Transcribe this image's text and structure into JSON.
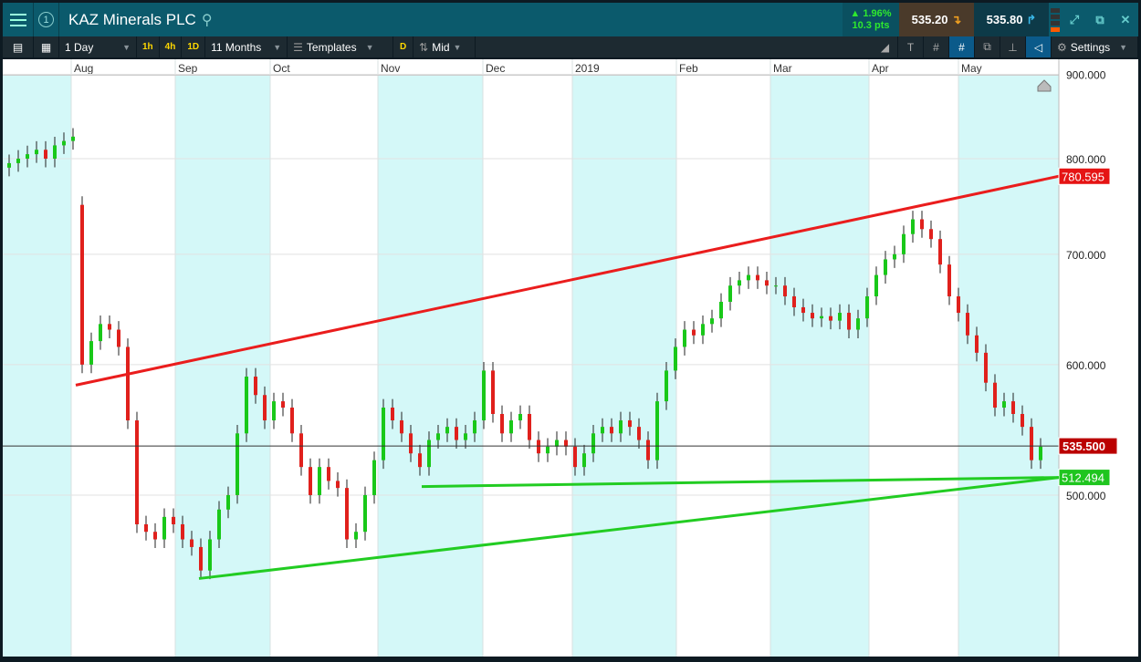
{
  "header": {
    "title": "KAZ Minerals PLC",
    "window_number": "1",
    "change_pct": "▲ 1.96%",
    "change_pts": "10.3 pts",
    "sell": "535.20",
    "buy": "535.80"
  },
  "toolbar": {
    "interval": "1 Day",
    "quick": [
      "1h",
      "4h",
      "1D"
    ],
    "range": "11 Months",
    "templates": "Templates",
    "d": "D",
    "price_type": "Mid",
    "settings": "Settings"
  },
  "colors": {
    "up": "#19c819",
    "down": "#e0201c",
    "band": "#d4f8f8",
    "red_line": "#ea1d1d",
    "green_line": "#22cc22"
  },
  "chart_data": {
    "type": "candlestick",
    "scale": "log",
    "ylim": [
      415,
      930
    ],
    "months": [
      {
        "label": "Aug",
        "i": 7
      },
      {
        "label": "Sep",
        "i": 18.4
      },
      {
        "label": "Oct",
        "i": 28.8
      },
      {
        "label": "Nov",
        "i": 40.6
      },
      {
        "label": "Dec",
        "i": 52.1
      },
      {
        "label": "2019",
        "i": 61.9
      },
      {
        "label": "Feb",
        "i": 73.3
      },
      {
        "label": "Mar",
        "i": 83.6
      },
      {
        "label": "Apr",
        "i": 94.4
      },
      {
        "label": "May",
        "i": 104.2
      }
    ],
    "yticks": [
      {
        "v": 900,
        "label": "900.000"
      },
      {
        "v": 800,
        "label": "800.000"
      },
      {
        "v": 700,
        "label": "700.000"
      },
      {
        "v": 600,
        "label": "600.000"
      },
      {
        "v": 500,
        "label": "500.000"
      }
    ],
    "closes": [
      795,
      800,
      805,
      810,
      800,
      815,
      820,
      825,
      600,
      620,
      635,
      630,
      615,
      555,
      480,
      475,
      470,
      485,
      480,
      470,
      465,
      450,
      470,
      490,
      500,
      545,
      590,
      575,
      555,
      570,
      565,
      545,
      520,
      500,
      520,
      510,
      505,
      470,
      475,
      500,
      525,
      565,
      555,
      545,
      530,
      520,
      540,
      545,
      550,
      540,
      545,
      555,
      595,
      560,
      545,
      555,
      560,
      540,
      530,
      535,
      540,
      535,
      520,
      530,
      545,
      550,
      545,
      555,
      550,
      540,
      525,
      570,
      595,
      615,
      630,
      625,
      635,
      640,
      655,
      670,
      675,
      680,
      675,
      670,
      670,
      660,
      650,
      645,
      640,
      642,
      638,
      645,
      630,
      640,
      660,
      680,
      695,
      700,
      720,
      735,
      725,
      715,
      690,
      660,
      645,
      625,
      610,
      585,
      565,
      570,
      560,
      550,
      525,
      535
    ],
    "first_open": 790,
    "gap_open": 750,
    "current": {
      "value": 535.5,
      "label": "535.500"
    },
    "trendlines": [
      {
        "color": "red",
        "i0": 7.5,
        "p0": 583,
        "i1": 115.2,
        "p1": 780.595,
        "label": "780.595"
      },
      {
        "color": "green",
        "i0": 21,
        "p0": 445,
        "i1": 115.2,
        "p1": 512.494,
        "label": "512.494"
      },
      {
        "color": "green",
        "i0": 45.4,
        "p0": 506,
        "i1": 115.2,
        "p1": 512.494
      }
    ]
  }
}
